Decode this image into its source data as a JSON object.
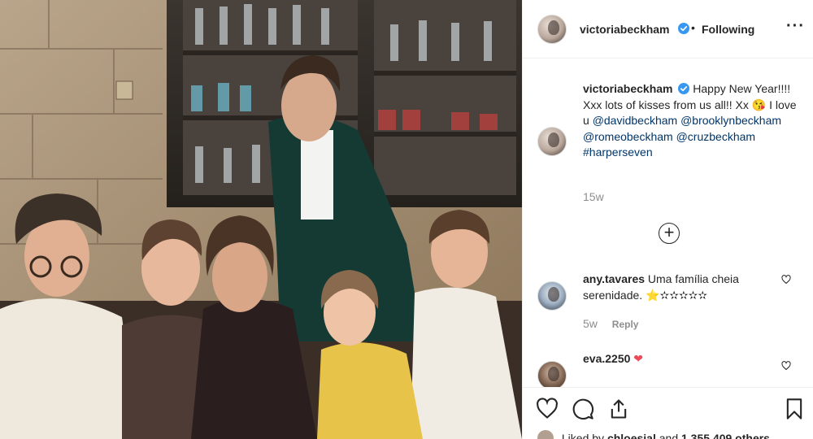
{
  "post": {
    "username": "victoriabeckham",
    "dot": "•",
    "follow_status": "Following",
    "more_icon": "more-horizontal-icon"
  },
  "caption": {
    "username": "victoriabeckham",
    "text_1": "Happy New Year!!!! Xxx lots of kisses from us all!! Xx",
    "emoji": "😘",
    "text_2": "I love u",
    "tags": [
      "@davidbeckham",
      "@brooklynbeckham",
      "@romeobeckham",
      "@cruzbeckham",
      "#harperseven"
    ],
    "age": "15w"
  },
  "load_more_icon": "plus-circle-icon",
  "comments": [
    {
      "username": "any.tavares",
      "text": "Uma família cheia serenidade.",
      "stars": "⭐✫✫✫✫✫",
      "age": "5w",
      "reply_label": "Reply"
    },
    {
      "username": "eva.2250",
      "heart": "❤"
    }
  ],
  "actions": {
    "like_icon": "heart-icon",
    "comment_icon": "comment-icon",
    "share_icon": "share-icon",
    "save_icon": "bookmark-icon"
  },
  "likes": {
    "prefix": "Liked by",
    "user": "chloesjal",
    "and": "and",
    "count": "1,355,409 others"
  },
  "colors": {
    "link": "#003569",
    "verified": "#3897f0",
    "muted": "#8e8e8e",
    "heart_red": "#ed4956"
  }
}
